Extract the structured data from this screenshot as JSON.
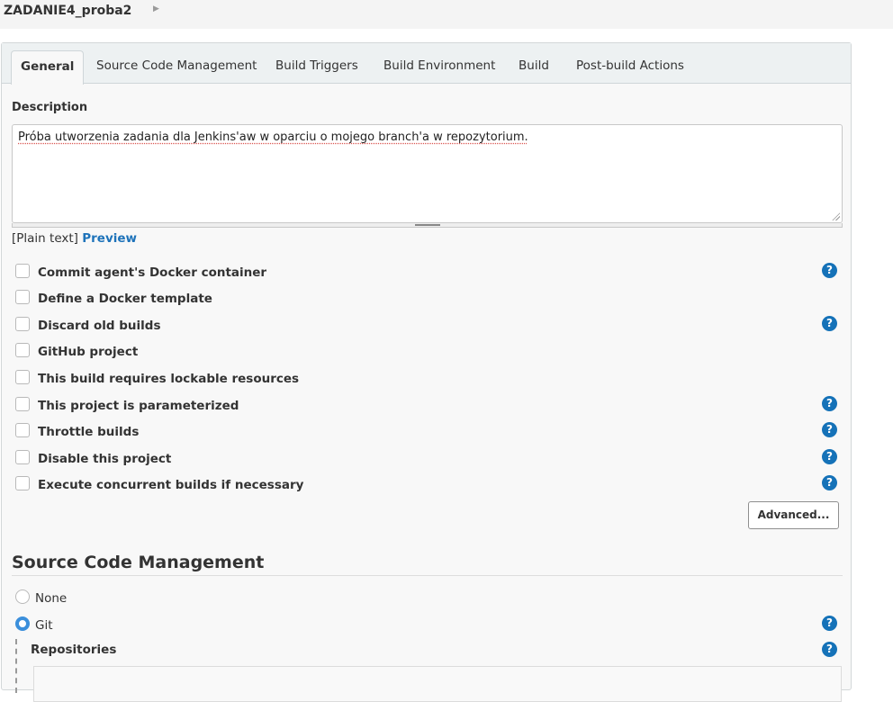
{
  "breadcrumb": {
    "title": "ZADANIE4_proba2"
  },
  "tabs": [
    {
      "label": "General",
      "active": true
    },
    {
      "label": "Source Code Management"
    },
    {
      "label": "Build Triggers"
    },
    {
      "label": "Build Environment"
    },
    {
      "label": "Build"
    },
    {
      "label": "Post-build Actions"
    }
  ],
  "description": {
    "label": "Description",
    "value": "Próba utworzenia zadania dla Jenkins'aw w oparciu o mojego branch'a w repozytorium.",
    "format_label": "[Plain text]",
    "preview_link": "Preview"
  },
  "options": [
    {
      "label": "Commit agent's Docker container",
      "help": true
    },
    {
      "label": "Define a Docker template",
      "help": false
    },
    {
      "label": "Discard old builds",
      "help": true
    },
    {
      "label": "GitHub project",
      "help": false
    },
    {
      "label": "This build requires lockable resources",
      "help": false
    },
    {
      "label": "This project is parameterized",
      "help": true
    },
    {
      "label": "Throttle builds",
      "help": true
    },
    {
      "label": "Disable this project",
      "help": true
    },
    {
      "label": "Execute concurrent builds if necessary",
      "help": true
    }
  ],
  "help_glyph": "?",
  "advanced_button": "Advanced...",
  "scm": {
    "heading": "Source Code Management",
    "options": [
      {
        "label": "None",
        "selected": false
      },
      {
        "label": "Git",
        "selected": true
      }
    ],
    "repositories_label": "Repositories"
  },
  "colors": {
    "accent": "#1572b8",
    "link": "#1e73ba",
    "radio_selected": "#3b8fdb"
  }
}
